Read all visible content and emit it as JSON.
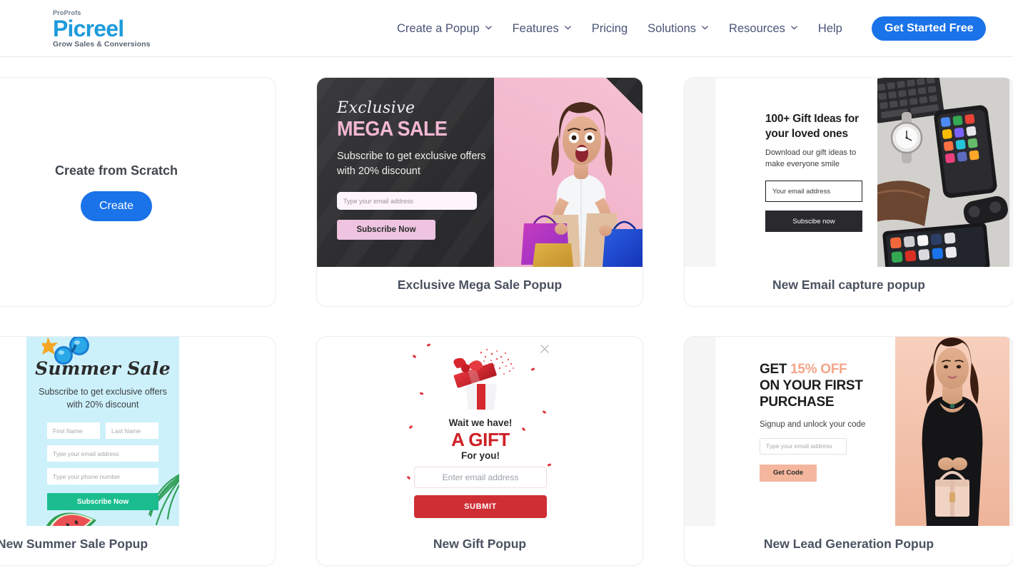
{
  "header": {
    "logo": {
      "pro": "ProProfs",
      "name": "Picreel",
      "tagline": "Grow Sales & Conversions"
    },
    "nav": [
      {
        "label": "Create a Popup",
        "has_caret": true
      },
      {
        "label": "Features",
        "has_caret": true
      },
      {
        "label": "Pricing",
        "has_caret": false
      },
      {
        "label": "Solutions",
        "has_caret": true
      },
      {
        "label": "Resources",
        "has_caret": true
      },
      {
        "label": "Help",
        "has_caret": false
      }
    ],
    "cta_label": "Get Started Free",
    "cta_color": "#1a73e8"
  },
  "scratch": {
    "title": "Create from Scratch",
    "button_label": "Create"
  },
  "cards": {
    "mega": {
      "title": "Exclusive Mega Sale Popup",
      "eyebrow": "Exclusive",
      "heading": "MEGA SALE",
      "subtext": "Subscribe to get exclusive offers with 20% discount",
      "input_placeholder": "Type your email address",
      "button_label": "Subscribe Now",
      "accent": "#f4b8d4",
      "background": "#2c2c2e"
    },
    "email": {
      "title": "New Email capture popup",
      "heading": "100+ Gift Ideas for your loved ones",
      "subtext": "Download our gift ideas to make everyone smile",
      "input_placeholder": "Your email address",
      "button_label": "Subscibe now",
      "accent": "#2a2a2e"
    },
    "summer": {
      "title": "New Summer Sale Popup",
      "heading": "Summer Sale",
      "subtext": "Subscribe to get exclusive offers with 20% discount",
      "first_name_placeholder": "First Name",
      "last_name_placeholder": "Last Name",
      "email_placeholder": "Type your email address",
      "phone_placeholder": "Type your phone number",
      "button_label": "Subscribe Now",
      "accent": "#1bbd8f",
      "background": "#cdf1fb"
    },
    "gift": {
      "title": "New Gift Popup",
      "line1": "Wait we have!",
      "line2": "A GIFT",
      "line3": "For you!",
      "input_placeholder": "Enter email address",
      "button_label": "SUBMIT",
      "close_icon": "close-icon",
      "accent": "#cf2e35"
    },
    "lead": {
      "title": "New Lead Generation Popup",
      "heading_get": "GET",
      "heading_off": "15% OFF",
      "heading_rest": "ON YOUR FIRST PURCHASE",
      "subtext": "Signup and unlock your code",
      "input_placeholder": "Type your email address",
      "button_label": "Get Code",
      "accent": "#f4b79e"
    }
  }
}
